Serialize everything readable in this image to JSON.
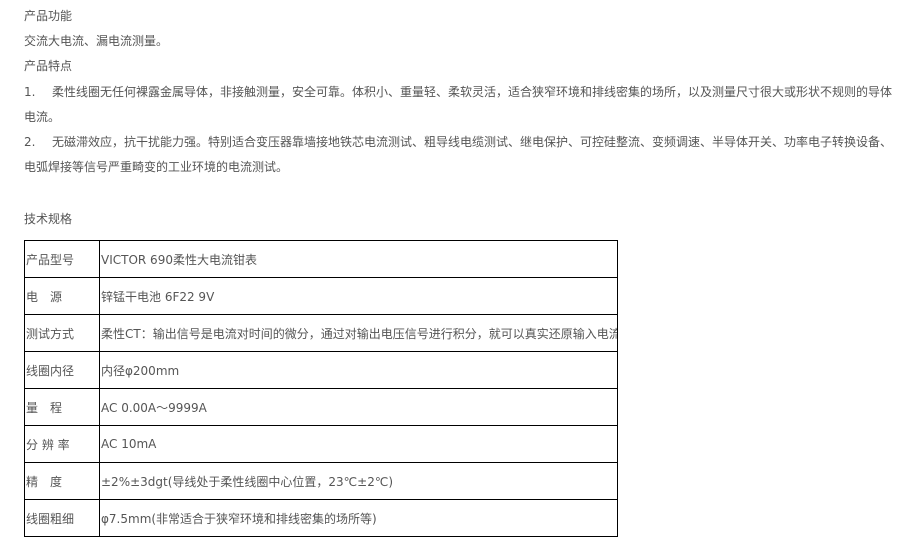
{
  "function_heading": "产品功能",
  "function_text": "交流大电流、漏电流测量。",
  "features_heading": "产品特点",
  "features": [
    {
      "num": "1.",
      "line1": "柔性线圈无任何裸露金属导体，非接触测量，安全可靠。体积小、重量轻、柔软灵活，适合狭窄环境和排线密集的场所，以及测量尺寸很大或形状不规则的导体",
      "line2": "电流。"
    },
    {
      "num": "2.",
      "line1": "无磁滞效应，抗干扰能力强。特别适合变压器靠墙接地铁芯电流测试、粗导线电缆测试、继电保护、可控硅整流、变频调速、半导体开关、功率电子转换设备、",
      "line2": "电弧焊接等信号严重畸变的工业环境的电流测试。"
    }
  ],
  "specs_heading": "技术规格",
  "specs": [
    {
      "label": "产品型号",
      "value": "VICTOR 690柔性大电流钳表"
    },
    {
      "label": "电　源",
      "value": "锌锰干电池 6F22 9V"
    },
    {
      "label": "测试方式",
      "value": "柔性CT：输出信号是电流对时间的微分，通过对输出电压信号进行积分，就可以真实还原输入电流"
    },
    {
      "label": "线圈内径",
      "value": "内径φ200mm"
    },
    {
      "label": "量　程",
      "value": "AC 0.00A～9999A"
    },
    {
      "label": "分 辨 率",
      "value": "AC 10mA"
    },
    {
      "label": "精　度",
      "value": "±2%±3dgt(导线处于柔性线圈中心位置，23℃±2℃)"
    },
    {
      "label": "线圈粗细",
      "value": "φ7.5mm(非常适合于狭窄环境和排线密集的场所等)"
    }
  ]
}
